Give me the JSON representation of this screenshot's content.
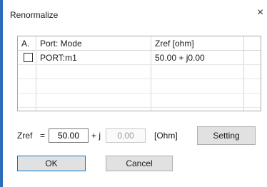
{
  "window": {
    "title": "Renormalize",
    "close_glyph": "×"
  },
  "table": {
    "headers": {
      "a": "A.",
      "port_mode": "Port: Mode",
      "zref": "Zref [ohm]"
    },
    "rows": [
      {
        "checked": false,
        "port_mode": "PORT:m1",
        "zref": "50.00 + j0.00"
      }
    ]
  },
  "zref": {
    "label": "Zref",
    "equals": "=",
    "real_value": "50.00",
    "plus_j": "+ j",
    "imag_value": "0.00",
    "unit": "[Ohm]"
  },
  "buttons": {
    "setting": "Setting",
    "ok": "OK",
    "cancel": "Cancel"
  },
  "colors": {
    "accent": "#2b6cb8",
    "default_button_border": "#0078d7"
  }
}
